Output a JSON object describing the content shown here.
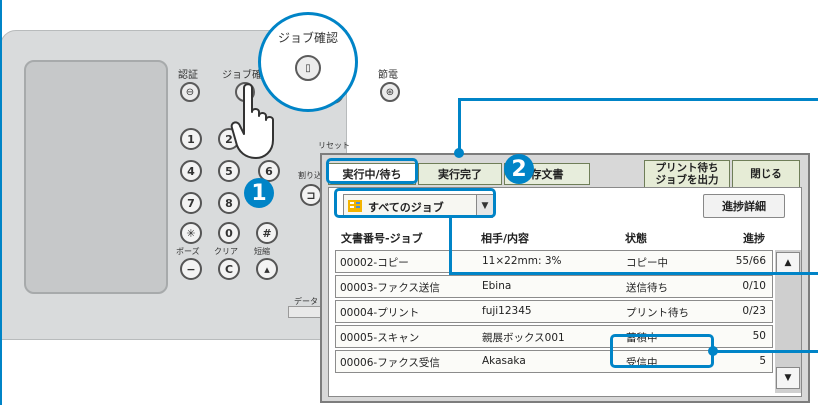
{
  "device": {
    "zoom_label": "ジョブ確認",
    "auth_label": "認証",
    "jobcheck_label": "ジョブ確認",
    "energy_label": "節電",
    "reset_label": "リセット",
    "interrupt_label": "割り込",
    "pause_label": "ポーズ",
    "clear_label": "クリア",
    "shortcut_label": "短縮",
    "data_label": "データ",
    "keys": [
      "1",
      "2",
      "3",
      "4",
      "5",
      "6",
      "7",
      "8",
      "9",
      "✳",
      "0",
      "#"
    ],
    "clear_key": "C",
    "callout_1": "1",
    "callout_2": "2"
  },
  "panel": {
    "tabs": [
      "実行中/待ち",
      "実行完了",
      "蓄積文書"
    ],
    "tab_stored_visible": "存文書",
    "print_waiting_button": "プリント待ち\nジョブを出力",
    "print_waiting_line1": "プリント待ち",
    "print_waiting_line2": "ジョブを出力",
    "close_button": "閉じる",
    "filter_dropdown": "すべてのジョブ",
    "progress_detail_button": "進捗詳細",
    "columns": [
      "文書番号-ジョブ",
      "相手/内容",
      "状態",
      "進捗"
    ],
    "rows": [
      {
        "job": "00002-コピー",
        "content": "11×22mm: 3%",
        "status": "コピー中",
        "progress": "55/66"
      },
      {
        "job": "00003-ファクス送信",
        "content": "Ebina",
        "status": "送信待ち",
        "progress": "0/10"
      },
      {
        "job": "00004-プリント",
        "content": "fuji12345",
        "status": "プリント待ち",
        "progress": "0/23"
      },
      {
        "job": "00005-スキャン",
        "content": "親展ボックス001",
        "status": "蓄積中",
        "progress": "50"
      },
      {
        "job": "00006-ファクス受信",
        "content": "Akasaka",
        "status": "受信中",
        "progress": "5"
      }
    ],
    "scroll_up": "▲",
    "scroll_down": "▼",
    "dropdown_arrow": "▼"
  },
  "colors": {
    "accent": "#0084c7",
    "tab_green": "#e7eddc"
  },
  "icons": [
    "jobcheck-icon",
    "auth-key-icon",
    "energy-saver-icon",
    "jobs-list-icon",
    "pointing-hand-icon"
  ]
}
